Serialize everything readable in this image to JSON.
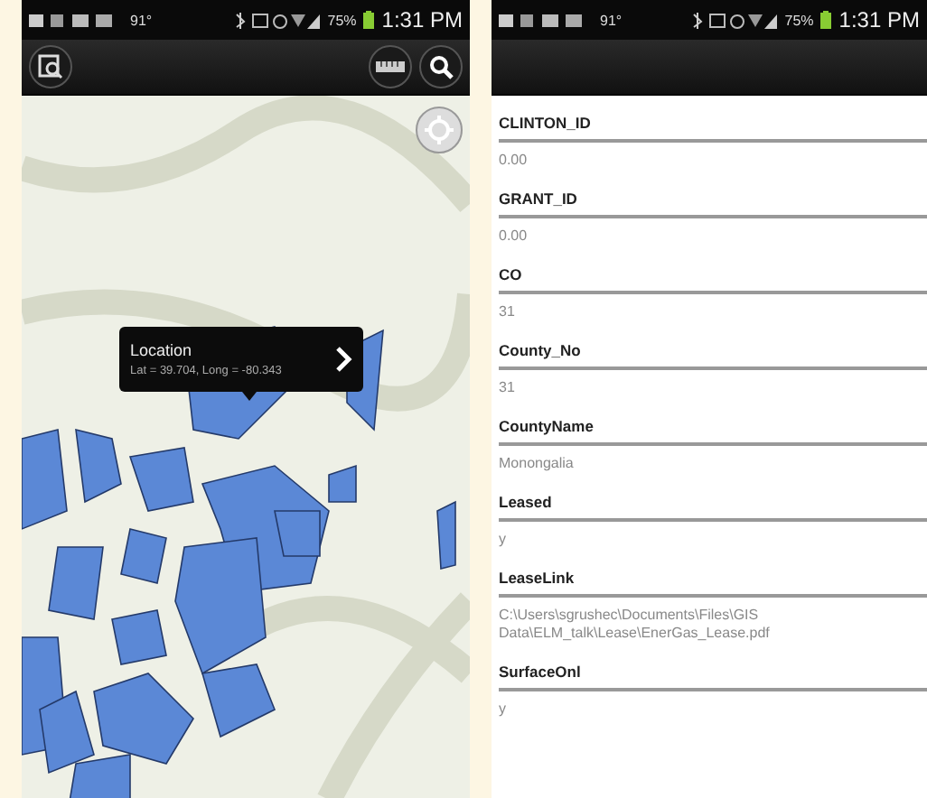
{
  "phones": [
    {
      "kind": "map",
      "status_bar": {
        "temperature": "91°",
        "battery": "75%",
        "time": "1:31 PM"
      },
      "callout": {
        "title": "Location",
        "coordinates": "Lat = 39.704, Long = -80.343"
      }
    },
    {
      "kind": "details",
      "status_bar": {
        "temperature": "91°",
        "battery": "75%",
        "time": "1:31 PM"
      },
      "fields": [
        {
          "label": "CLINTON_ID",
          "value": "0.00"
        },
        {
          "label": "GRANT_ID",
          "value": "0.00"
        },
        {
          "label": "CO",
          "value": "31"
        },
        {
          "label": "County_No",
          "value": "31"
        },
        {
          "label": "CountyName",
          "value": "Monongalia"
        },
        {
          "label": "Leased",
          "value": "y"
        },
        {
          "label": "LeaseLink",
          "value": "C:\\Users\\sgrushec\\Documents\\Files\\GIS Data\\ELM_talk\\Lease\\EnerGas_Lease.pdf"
        },
        {
          "label": "SurfaceOnl",
          "value": "y"
        }
      ]
    }
  ]
}
